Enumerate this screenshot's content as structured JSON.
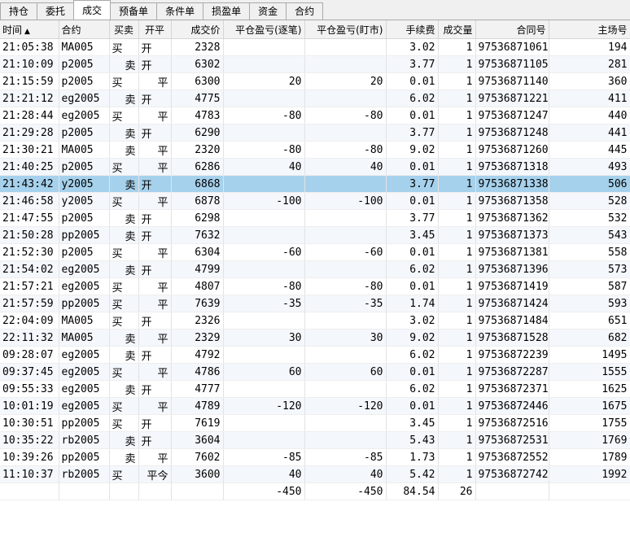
{
  "tabs": [
    {
      "label": "持仓"
    },
    {
      "label": "委托"
    },
    {
      "label": "成交",
      "active": true
    },
    {
      "label": "预备单"
    },
    {
      "label": "条件单"
    },
    {
      "label": "损盈单"
    },
    {
      "label": "资金"
    },
    {
      "label": "合约"
    }
  ],
  "columns": {
    "time": "时间",
    "contract": "合约",
    "side": "买卖",
    "oc": "开平",
    "price": "成交价",
    "pnl_close": "平仓盈亏(逐笔)",
    "pnl_mtm": "平仓盈亏(盯市)",
    "fee": "手续费",
    "qty": "成交量",
    "order_no": "合同号",
    "exch_no": "主场号"
  },
  "colors": {
    "buy": "#e60000",
    "sell": "#008000",
    "selected_row": "#a6d1ec"
  },
  "rows": [
    {
      "time": "21:05:38",
      "contract": "MA005",
      "side": "买",
      "oc": "开",
      "price": "2328",
      "pnl_close": "",
      "pnl_mtm": "",
      "fee": "3.02",
      "qty": "1",
      "order_no": "97536871061",
      "exch_no": "194"
    },
    {
      "time": "21:10:09",
      "contract": "p2005",
      "side": "卖",
      "oc": "开",
      "price": "6302",
      "pnl_close": "",
      "pnl_mtm": "",
      "fee": "3.77",
      "qty": "1",
      "order_no": "97536871105",
      "exch_no": "281"
    },
    {
      "time": "21:15:59",
      "contract": "p2005",
      "side": "买",
      "oc": "平",
      "price": "6300",
      "pnl_close": "20",
      "pnl_mtm": "20",
      "fee": "0.01",
      "qty": "1",
      "order_no": "97536871140",
      "exch_no": "360"
    },
    {
      "time": "21:21:12",
      "contract": "eg2005",
      "side": "卖",
      "oc": "开",
      "price": "4775",
      "pnl_close": "",
      "pnl_mtm": "",
      "fee": "6.02",
      "qty": "1",
      "order_no": "97536871221",
      "exch_no": "411"
    },
    {
      "time": "21:28:44",
      "contract": "eg2005",
      "side": "买",
      "oc": "平",
      "price": "4783",
      "pnl_close": "-80",
      "pnl_mtm": "-80",
      "fee": "0.01",
      "qty": "1",
      "order_no": "97536871247",
      "exch_no": "440"
    },
    {
      "time": "21:29:28",
      "contract": "p2005",
      "side": "卖",
      "oc": "开",
      "price": "6290",
      "pnl_close": "",
      "pnl_mtm": "",
      "fee": "3.77",
      "qty": "1",
      "order_no": "97536871248",
      "exch_no": "441"
    },
    {
      "time": "21:30:21",
      "contract": "MA005",
      "side": "卖",
      "oc": "平",
      "price": "2320",
      "pnl_close": "-80",
      "pnl_mtm": "-80",
      "fee": "9.02",
      "qty": "1",
      "order_no": "97536871260",
      "exch_no": "445"
    },
    {
      "time": "21:40:25",
      "contract": "p2005",
      "side": "买",
      "oc": "平",
      "price": "6286",
      "pnl_close": "40",
      "pnl_mtm": "40",
      "fee": "0.01",
      "qty": "1",
      "order_no": "97536871318",
      "exch_no": "493"
    },
    {
      "time": "21:43:42",
      "contract": "y2005",
      "side": "卖",
      "oc": "开",
      "price": "6868",
      "pnl_close": "",
      "pnl_mtm": "",
      "fee": "3.77",
      "qty": "1",
      "order_no": "97536871338",
      "exch_no": "506",
      "selected": true
    },
    {
      "time": "21:46:58",
      "contract": "y2005",
      "side": "买",
      "oc": "平",
      "price": "6878",
      "pnl_close": "-100",
      "pnl_mtm": "-100",
      "fee": "0.01",
      "qty": "1",
      "order_no": "97536871358",
      "exch_no": "528"
    },
    {
      "time": "21:47:55",
      "contract": "p2005",
      "side": "卖",
      "oc": "开",
      "price": "6298",
      "pnl_close": "",
      "pnl_mtm": "",
      "fee": "3.77",
      "qty": "1",
      "order_no": "97536871362",
      "exch_no": "532"
    },
    {
      "time": "21:50:28",
      "contract": "pp2005",
      "side": "卖",
      "oc": "开",
      "price": "7632",
      "pnl_close": "",
      "pnl_mtm": "",
      "fee": "3.45",
      "qty": "1",
      "order_no": "97536871373",
      "exch_no": "543"
    },
    {
      "time": "21:52:30",
      "contract": "p2005",
      "side": "买",
      "oc": "平",
      "price": "6304",
      "pnl_close": "-60",
      "pnl_mtm": "-60",
      "fee": "0.01",
      "qty": "1",
      "order_no": "97536871381",
      "exch_no": "558"
    },
    {
      "time": "21:54:02",
      "contract": "eg2005",
      "side": "卖",
      "oc": "开",
      "price": "4799",
      "pnl_close": "",
      "pnl_mtm": "",
      "fee": "6.02",
      "qty": "1",
      "order_no": "97536871396",
      "exch_no": "573"
    },
    {
      "time": "21:57:21",
      "contract": "eg2005",
      "side": "买",
      "oc": "平",
      "price": "4807",
      "pnl_close": "-80",
      "pnl_mtm": "-80",
      "fee": "0.01",
      "qty": "1",
      "order_no": "97536871419",
      "exch_no": "587"
    },
    {
      "time": "21:57:59",
      "contract": "pp2005",
      "side": "买",
      "oc": "平",
      "price": "7639",
      "pnl_close": "-35",
      "pnl_mtm": "-35",
      "fee": "1.74",
      "qty": "1",
      "order_no": "97536871424",
      "exch_no": "593"
    },
    {
      "time": "22:04:09",
      "contract": "MA005",
      "side": "买",
      "oc": "开",
      "price": "2326",
      "pnl_close": "",
      "pnl_mtm": "",
      "fee": "3.02",
      "qty": "1",
      "order_no": "97536871484",
      "exch_no": "651"
    },
    {
      "time": "22:11:32",
      "contract": "MA005",
      "side": "卖",
      "oc": "平",
      "price": "2329",
      "pnl_close": "30",
      "pnl_mtm": "30",
      "fee": "9.02",
      "qty": "1",
      "order_no": "97536871528",
      "exch_no": "682"
    },
    {
      "time": "09:28:07",
      "contract": "eg2005",
      "side": "卖",
      "oc": "开",
      "price": "4792",
      "pnl_close": "",
      "pnl_mtm": "",
      "fee": "6.02",
      "qty": "1",
      "order_no": "97536872239",
      "exch_no": "1495"
    },
    {
      "time": "09:37:45",
      "contract": "eg2005",
      "side": "买",
      "oc": "平",
      "price": "4786",
      "pnl_close": "60",
      "pnl_mtm": "60",
      "fee": "0.01",
      "qty": "1",
      "order_no": "97536872287",
      "exch_no": "1555"
    },
    {
      "time": "09:55:33",
      "contract": "eg2005",
      "side": "卖",
      "oc": "开",
      "price": "4777",
      "pnl_close": "",
      "pnl_mtm": "",
      "fee": "6.02",
      "qty": "1",
      "order_no": "97536872371",
      "exch_no": "1625"
    },
    {
      "time": "10:01:19",
      "contract": "eg2005",
      "side": "买",
      "oc": "平",
      "price": "4789",
      "pnl_close": "-120",
      "pnl_mtm": "-120",
      "fee": "0.01",
      "qty": "1",
      "order_no": "97536872446",
      "exch_no": "1675"
    },
    {
      "time": "10:30:51",
      "contract": "pp2005",
      "side": "买",
      "oc": "开",
      "price": "7619",
      "pnl_close": "",
      "pnl_mtm": "",
      "fee": "3.45",
      "qty": "1",
      "order_no": "97536872516",
      "exch_no": "1755"
    },
    {
      "time": "10:35:22",
      "contract": "rb2005",
      "side": "卖",
      "oc": "开",
      "price": "3604",
      "pnl_close": "",
      "pnl_mtm": "",
      "fee": "5.43",
      "qty": "1",
      "order_no": "97536872531",
      "exch_no": "1769"
    },
    {
      "time": "10:39:26",
      "contract": "pp2005",
      "side": "卖",
      "oc": "平",
      "price": "7602",
      "pnl_close": "-85",
      "pnl_mtm": "-85",
      "fee": "1.73",
      "qty": "1",
      "order_no": "97536872552",
      "exch_no": "1789"
    },
    {
      "time": "11:10:37",
      "contract": "rb2005",
      "side": "买",
      "oc": "平今",
      "price": "3600",
      "pnl_close": "40",
      "pnl_mtm": "40",
      "fee": "5.42",
      "qty": "1",
      "order_no": "97536872742",
      "exch_no": "1992"
    }
  ],
  "summary": {
    "pnl_close": "-450",
    "pnl_mtm": "-450",
    "fee": "84.54",
    "qty": "26"
  }
}
